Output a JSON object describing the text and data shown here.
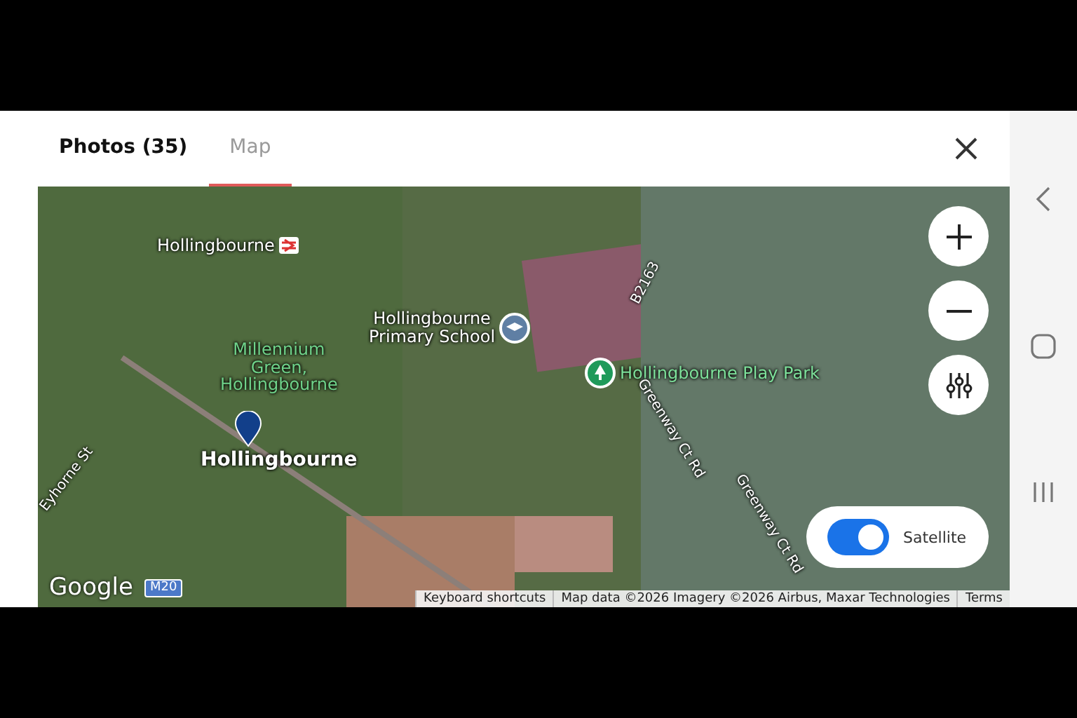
{
  "tabs": [
    {
      "label": "Photos (35)",
      "selected": false
    },
    {
      "label": "Map",
      "selected": true
    }
  ],
  "map": {
    "labels": [
      {
        "kind": "station",
        "text": "Hollingbourne"
      },
      {
        "kind": "road",
        "text": "B2163"
      },
      {
        "kind": "school",
        "text": "Hollingbourne\nPrimary School"
      },
      {
        "kind": "green",
        "text": "Millennium\nGreen,\nHollingbourne"
      },
      {
        "kind": "park",
        "text": "Hollingbourne Play Park"
      },
      {
        "kind": "town",
        "text": "Hollingbourne"
      },
      {
        "kind": "road",
        "text": "Greenway Ct Rd"
      },
      {
        "kind": "road",
        "text": "Eyhorne St"
      },
      {
        "kind": "road",
        "text": "Greenway Ct Rd"
      },
      {
        "kind": "shield",
        "text": "M20"
      }
    ],
    "logo": "Google",
    "satellite": {
      "label": "Satellite",
      "on": true
    },
    "attribution": [
      "Keyboard shortcuts",
      "Map data ©2026 Imagery ©2026 Airbus, Maxar Technologies",
      "Terms"
    ]
  }
}
